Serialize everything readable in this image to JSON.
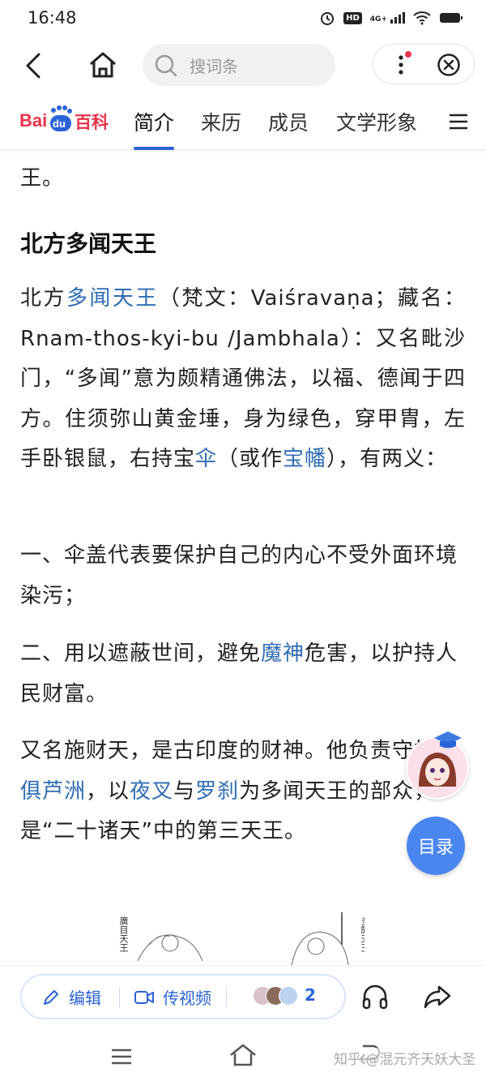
{
  "status_bar": {
    "time": "16:48",
    "hd_label": "HD",
    "signal_label": "4G+",
    "icons": [
      "alarm-icon",
      "hd-icon",
      "signal-icon",
      "wifi-icon",
      "battery-icon"
    ]
  },
  "toolbar": {
    "search_placeholder": "搜词条",
    "icons": [
      "back-icon",
      "home-icon",
      "search-icon",
      "more-icon",
      "close-icon"
    ],
    "notification_color": "#e8334a"
  },
  "brand": {
    "logo_text_a": "Bai",
    "logo_text_b": "du",
    "logo_text_c": "百科",
    "red": "#e8334a",
    "blue": "#2a63d7"
  },
  "tabs": [
    {
      "label": "简介",
      "active": true
    },
    {
      "label": "来历",
      "active": false
    },
    {
      "label": "成员",
      "active": false
    },
    {
      "label": "文学形象",
      "active": false
    }
  ],
  "content": {
    "prev_tail": "王。",
    "section_title": "北方多闻天王",
    "para1": {
      "t1": "北方",
      "l1": "多闻天王",
      "t2": "（梵文：Vaiśravaṇa；藏名：Rnam-thos-kyi-bu /Jambhala）：又名毗沙门，“多闻”意为颇精通佛法，以福、德闻于四方。住须弥山黄金埵，身为绿色，穿甲胄，左手卧银鼠，右持宝",
      "l2": "伞",
      "t3": "（或作",
      "l3": "宝幡",
      "t4": "），有两义："
    },
    "para2": "一、伞盖代表要保护自己的内心不受外面环境染污；",
    "para3": {
      "t1": "二、用以遮蔽世间，避免",
      "l1": "魔神",
      "t2": "危害，以护持人民财富。"
    },
    "para4": {
      "t1": "又名施财天，是古印度的财神。他负责守护",
      "l1": "北俱芦洲",
      "t2": "，以",
      "l2": "夜叉",
      "t3": "与",
      "l3": "罗刹",
      "t4": "为多闻天王的部众，是“二十诸天”中的第三天王。"
    },
    "figure_captions": [
      "廣目天王",
      "多聞天王"
    ]
  },
  "floating": {
    "toc_label": "目录",
    "avatar_icon": "anime-avatar-icon"
  },
  "bottom_actions": {
    "edit_label": "编辑",
    "video_label": "传视频",
    "contributors_count": "2",
    "icons": [
      "pencil-icon",
      "video-camera-icon",
      "contributor-avatars-icon",
      "headphones-icon",
      "share-icon"
    ]
  },
  "nav_bar": {
    "icons": [
      "menu-icon",
      "home-outline-icon",
      "back-arrow-icon"
    ],
    "watermark": "知乎 @混元齐天妖大圣"
  },
  "link_color": "#2f6cb5"
}
